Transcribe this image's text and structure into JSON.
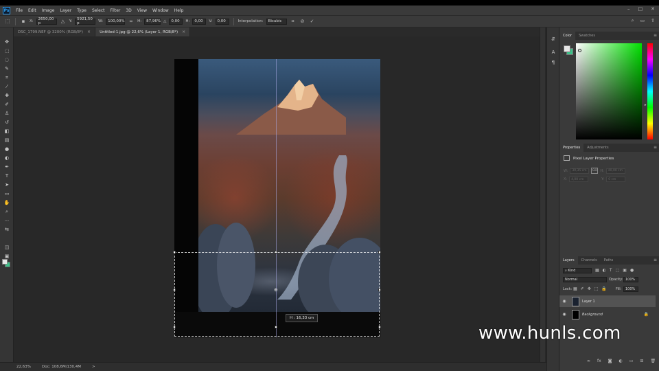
{
  "app": {
    "logo": "Ps",
    "menu": [
      "File",
      "Edit",
      "Image",
      "Layer",
      "Type",
      "Select",
      "Filter",
      "3D",
      "View",
      "Window",
      "Help"
    ],
    "window_controls": [
      "–",
      "□",
      "✕"
    ]
  },
  "options": {
    "x_label": "X:",
    "x_value": "2650,00 p",
    "y_label": "Y:",
    "y_value": "5921,50 p",
    "w_label": "W:",
    "w_value": "100,00%",
    "h_label": "H:",
    "h_value": "87,96%",
    "rot_label": "△",
    "rot_value": "0,00",
    "hskew_label": "H:",
    "hskew_value": "0,00",
    "vskew_label": "V:",
    "vskew_value": "0,00",
    "interp_label": "Interpolation:",
    "interp_value": "Bicubic"
  },
  "tabs": [
    {
      "label": "DSC_1799.NEF @ 3200% (RGB/8*)",
      "close": "×"
    },
    {
      "label": "Untitled-1.jpg @ 22,6% (Layer 1, RGB/8*)",
      "close": "×"
    }
  ],
  "canvas": {
    "readout": "H : 16,33 cm"
  },
  "status": {
    "zoom": "22,63%",
    "doc": "Doc: 108,6M/130,4M",
    "arrow": ">"
  },
  "panels": {
    "color_tabs": [
      "Color",
      "Swatches"
    ],
    "properties_tabs": [
      "Properties",
      "Adjustments"
    ],
    "properties_title": "Pixel Layer Properties",
    "prop_w_label": "W:",
    "prop_w_value": "30,35 cm",
    "prop_h_label": "H:",
    "prop_h_value": "40,00 cm",
    "prop_x_label": "X:",
    "prop_x_value": "4,00 cm",
    "prop_y_label": "Y:",
    "prop_y_value": "0 cm",
    "layers_tabs": [
      "Layers",
      "Channels",
      "Paths"
    ],
    "kind_value": "Kind",
    "blend_value": "Normal",
    "opacity_label": "Opacity:",
    "opacity_value": "100%",
    "lock_label": "Lock:",
    "fill_label": "Fill:",
    "fill_value": "100%",
    "layers": [
      {
        "name": "Layer 1"
      },
      {
        "name": "Background"
      }
    ]
  },
  "watermark": "www.hunls.com"
}
